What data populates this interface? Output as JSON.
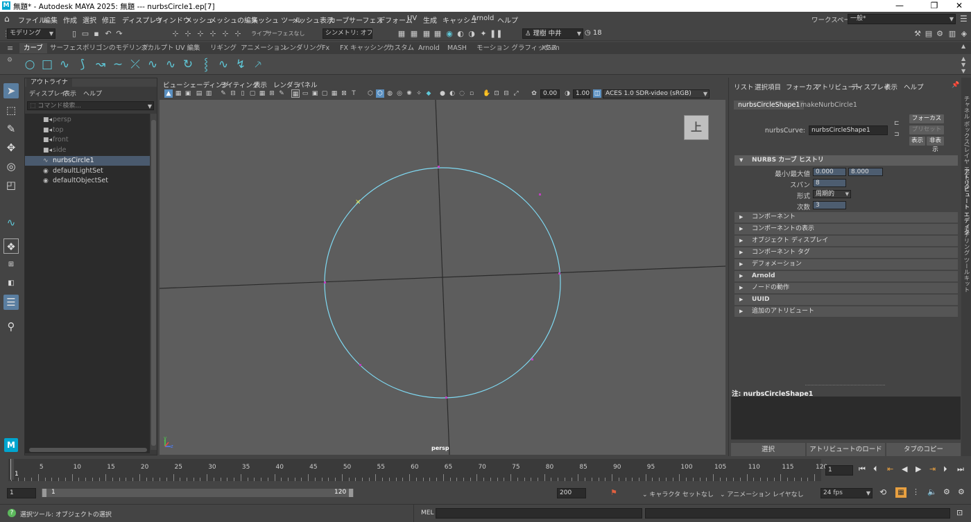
{
  "titlebar": {
    "title": "無題* - Autodesk MAYA 2025: 無題   ---   nurbsCircle1.ep[7]",
    "logo": "M",
    "minimize": "—",
    "maximize": "❐",
    "close": "✕"
  },
  "menu": [
    "ファイル",
    "編集",
    "作成",
    "選択",
    "修正",
    "ディスプレイ",
    "ウィンドウ",
    "メッシュ",
    "メッシュの編集",
    "メッシュ ツール",
    "メッシュ表示",
    "カーブ",
    "サーフェス",
    "デフォーム",
    "UV",
    "生成",
    "キャッシュ",
    "Arnold",
    "ヘルプ"
  ],
  "workspace": {
    "label": "ワークスペース :",
    "value": "一般*"
  },
  "status": {
    "menuset": "モデリング",
    "live": "ライブ",
    "surface": "サーフェスなし",
    "symmetry": "シンメトリ: オフ",
    "user": "理樹 中井",
    "clock": "18"
  },
  "shelf_tabs": [
    "カーブ",
    "サーフェス",
    "ポリゴンのモデリング",
    "スカルプト",
    "UV 編集",
    "リギング",
    "アニメーション",
    "レンダリング",
    "Fx",
    "FX キャッシング",
    "カスタム",
    "Arnold",
    "MASH",
    "モーション グラフィックス",
    "XGen"
  ],
  "shelf_active": "カーブ",
  "outliner": {
    "title": "アウトライナ",
    "menu": [
      "ディスプレイ",
      "表示",
      "ヘルプ"
    ],
    "search_placeholder": "コマンド検索...",
    "items": [
      {
        "label": "persp",
        "icon": "■◂",
        "dim": true
      },
      {
        "label": "top",
        "icon": "■◂",
        "dim": true
      },
      {
        "label": "front",
        "icon": "■◂",
        "dim": true
      },
      {
        "label": "side",
        "icon": "■◂",
        "dim": true
      },
      {
        "label": "nurbsCircle1",
        "icon": "∿",
        "selected": true
      },
      {
        "label": "defaultLightSet",
        "icon": "◉"
      },
      {
        "label": "defaultObjectSet",
        "icon": "◉"
      }
    ]
  },
  "viewport": {
    "menu": [
      "ビュー",
      "シェーディング",
      "ライティング",
      "表示",
      "レンダラ",
      "パネル"
    ],
    "exposure": "0.00",
    "gamma": "1.00",
    "colorspace": "ACES 1.0 SDR-video (sRGB)",
    "camera_label": "persp",
    "viewcube_label": "上",
    "axis_y": "y",
    "axis_z": "z",
    "curve_color": "#7fd9f2",
    "grid_color": "#2b2b2b",
    "background": "#5d5d5d"
  },
  "attr": {
    "menu": [
      "リスト",
      "選択項目",
      "フォーカス",
      "アトリビュート",
      "ディスプレイ",
      "表示",
      "ヘルプ"
    ],
    "tabs": [
      "nurbsCircleShape1",
      "makeNurbCircle1"
    ],
    "curve_label": "nurbsCurve:",
    "curve_value": "nurbsCircleShape1",
    "btn_focus": "フォーカス",
    "btn_preset": "プリセット",
    "btn_show": "表示",
    "btn_hide": "非表示",
    "sections": [
      {
        "label": "NURBS カーブ ヒストリ",
        "open": true
      },
      {
        "label": "コンポーネント"
      },
      {
        "label": "コンポーネントの表示"
      },
      {
        "label": "オブジェクト ディスプレイ"
      },
      {
        "label": "コンポーネント タグ"
      },
      {
        "label": "デフォメーション"
      },
      {
        "label": "Arnold",
        "bold": true
      },
      {
        "label": "ノードの動作"
      },
      {
        "label": "UUID",
        "bold": true
      },
      {
        "label": "追加のアトリビュート"
      }
    ],
    "fields": {
      "minmax_label": "最小/最大値",
      "min": "0.000",
      "max": "8.000",
      "spans_label": "スパン",
      "spans": "8",
      "form_label": "形式",
      "form": "周期的",
      "degree_label": "次数",
      "degree": "3"
    },
    "note": "注:  nurbsCircleShape1",
    "bottom_buttons": [
      "選択",
      "アトリビュートのロード",
      "タブのコピー"
    ]
  },
  "side_tabs": [
    "チャネル ボックス/レイヤ エディタ",
    "アトリビュート エディタ",
    "モデリング ツールキット"
  ],
  "timeline": {
    "ticks": [
      "5",
      "10",
      "15",
      "20",
      "25",
      "30",
      "35",
      "40",
      "45",
      "50",
      "55",
      "60",
      "65",
      "70",
      "75",
      "80",
      "85",
      "90",
      "95",
      "100",
      "105",
      "110",
      "115",
      "120"
    ],
    "current_frame": "1",
    "current_field": "1"
  },
  "range": {
    "start": "1",
    "inner_start": "1",
    "inner_end": "120",
    "end": "200",
    "char_set": "キャラクタ セットなし",
    "anim_layer": "アニメーション レイヤなし",
    "fps": "24 fps"
  },
  "cmdline": {
    "help": "選択ツール: オブジェクトの選択",
    "lang": "MEL"
  }
}
